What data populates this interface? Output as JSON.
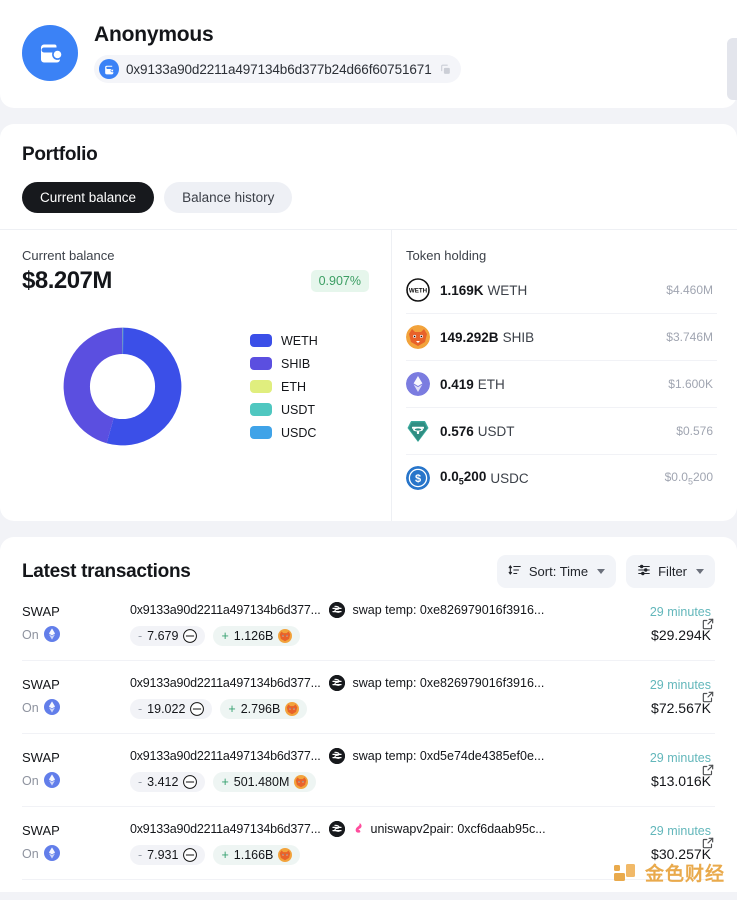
{
  "account": {
    "avatar_icon": "wallet-icon",
    "display_name": "Anonymous",
    "chain_icon": "wallet-chain-icon",
    "address": "0x9133a90d2211a497134b6d377b24d66f60751671",
    "copy_icon": "copy-icon"
  },
  "portfolio": {
    "title": "Portfolio",
    "tabs": [
      {
        "label": "Current balance",
        "active": true
      },
      {
        "label": "Balance history",
        "active": false
      }
    ],
    "balance": {
      "label": "Current balance",
      "value": "$8.207M",
      "change": "0.907%",
      "change_color": "#3b9e63",
      "change_bg": "#e6f6ec"
    },
    "holding_title": "Token holding",
    "holdings": [
      {
        "icon": "weth-token-icon",
        "amount": "1.169K",
        "symbol": "WETH",
        "usd": "$4.460M"
      },
      {
        "icon": "shib-token-icon",
        "amount": "149.292B",
        "symbol": "SHIB",
        "usd": "$3.746M"
      },
      {
        "icon": "eth-token-icon",
        "amount": "0.419",
        "symbol": "ETH",
        "usd": "$1.600K"
      },
      {
        "icon": "usdt-token-icon",
        "amount": "0.576",
        "symbol": "USDT",
        "usd": "$0.576"
      },
      {
        "icon": "usdc-token-icon",
        "amount": "0.0",
        "amount_sub": "5",
        "amount_tail": "200",
        "symbol": "USDC",
        "usd": "$0.0",
        "usd_sub": "5",
        "usd_tail": "200"
      }
    ]
  },
  "chart_data": {
    "type": "pie",
    "title": "Current balance",
    "legend_position": "right",
    "categories": [
      "WETH",
      "SHIB",
      "ETH",
      "USDT",
      "USDC"
    ],
    "values": [
      4.46,
      3.746,
      0.0016,
      5.76e-07,
      2e-10
    ],
    "value_unit": "millions USD",
    "percentages": [
      54.3,
      45.6,
      0.02,
      0.0,
      0.0
    ],
    "colors": [
      "#3b4fe8",
      "#5b4fe0",
      "#e0ee7e",
      "#4fc7c0",
      "#3fa3e8"
    ],
    "labels": [
      "$4.460M",
      "$3.746M",
      "$1.600K",
      "$0.576",
      "$0.05200"
    ],
    "donut": true,
    "inner_radius_ratio": 0.56
  },
  "transactions": {
    "title": "Latest transactions",
    "sort": {
      "icon": "sort-icon",
      "label": "Sort: Time",
      "caret": "chevron-down-icon"
    },
    "filter": {
      "icon": "filter-icon",
      "label": "Filter",
      "caret": "chevron-down-icon"
    },
    "rows": [
      {
        "type": "SWAP",
        "on_label": "On",
        "chain_icon": "ethereum-chain-icon",
        "hash": "0x9133a90d2211a497134b6d377...",
        "swap_icon": "swap-icon",
        "dest_icon": "",
        "dest": "swap temp: 0xe826979016f3916...",
        "out": {
          "sign": "-",
          "amount": "7.679",
          "token_icon": "weth-token-icon"
        },
        "in": {
          "sign": "+",
          "amount": "1.126B",
          "token_icon": "shib-token-icon"
        },
        "ago": "29 minutes",
        "usd": "$29.294K",
        "link_icon": "external-link-icon"
      },
      {
        "type": "SWAP",
        "on_label": "On",
        "chain_icon": "ethereum-chain-icon",
        "hash": "0x9133a90d2211a497134b6d377...",
        "swap_icon": "swap-icon",
        "dest_icon": "",
        "dest": "swap temp: 0xe826979016f3916...",
        "out": {
          "sign": "-",
          "amount": "19.022",
          "token_icon": "weth-token-icon"
        },
        "in": {
          "sign": "+",
          "amount": "2.796B",
          "token_icon": "shib-token-icon"
        },
        "ago": "29 minutes",
        "usd": "$72.567K",
        "link_icon": "external-link-icon"
      },
      {
        "type": "SWAP",
        "on_label": "On",
        "chain_icon": "ethereum-chain-icon",
        "hash": "0x9133a90d2211a497134b6d377...",
        "swap_icon": "swap-icon",
        "dest_icon": "",
        "dest": "swap temp: 0xd5e74de4385ef0e...",
        "out": {
          "sign": "-",
          "amount": "3.412",
          "token_icon": "weth-token-icon"
        },
        "in": {
          "sign": "+",
          "amount": "501.480M",
          "token_icon": "shib-token-icon"
        },
        "ago": "29 minutes",
        "usd": "$13.016K",
        "link_icon": "external-link-icon"
      },
      {
        "type": "SWAP",
        "on_label": "On",
        "chain_icon": "ethereum-chain-icon",
        "hash": "0x9133a90d2211a497134b6d377...",
        "swap_icon": "swap-icon",
        "dest_icon": "uniswap-icon",
        "dest": "uniswapv2pair: 0xcf6daab95c...",
        "out": {
          "sign": "-",
          "amount": "7.931",
          "token_icon": "weth-token-icon"
        },
        "in": {
          "sign": "+",
          "amount": "1.166B",
          "token_icon": "shib-token-icon"
        },
        "ago": "29 minutes",
        "usd": "$30.257K",
        "link_icon": "external-link-icon"
      }
    ]
  },
  "watermark": {
    "text": "金色财经",
    "color": "#e8a33d"
  }
}
